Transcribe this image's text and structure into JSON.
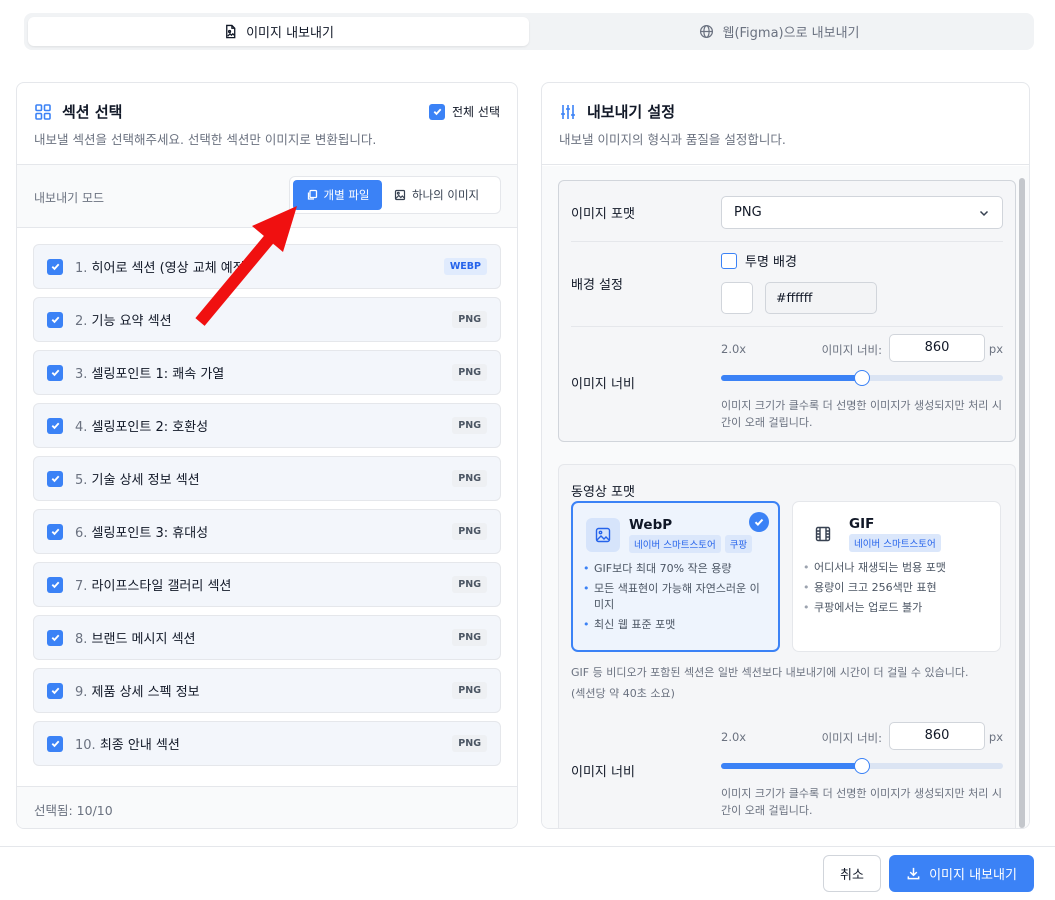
{
  "tabs": [
    {
      "label": "이미지 내보내기",
      "active": true
    },
    {
      "label": "웹(Figma)으로 내보내기",
      "active": false
    }
  ],
  "left": {
    "title": "섹션 선택",
    "subtitle": "내보낼 섹션을 선택해주세요. 선택한 섹션만 이미지로 변환됩니다.",
    "select_all": "전체 선택",
    "mode_label": "내보내기 모드",
    "mode_options": [
      "개별 파일",
      "하나의 이미지"
    ],
    "sections": [
      {
        "num": "1.",
        "name": "히어로 섹션 (영상 교체 예정)",
        "badge": "WEBP"
      },
      {
        "num": "2.",
        "name": "기능 요약 섹션",
        "badge": "PNG"
      },
      {
        "num": "3.",
        "name": "셀링포인트 1: 쾌속 가열",
        "badge": "PNG"
      },
      {
        "num": "4.",
        "name": "셀링포인트 2: 호환성",
        "badge": "PNG"
      },
      {
        "num": "5.",
        "name": "기술 상세 정보 섹션",
        "badge": "PNG"
      },
      {
        "num": "6.",
        "name": "셀링포인트 3: 휴대성",
        "badge": "PNG"
      },
      {
        "num": "7.",
        "name": "라이프스타일 갤러리 섹션",
        "badge": "PNG"
      },
      {
        "num": "8.",
        "name": "브랜드 메시지 섹션",
        "badge": "PNG"
      },
      {
        "num": "9.",
        "name": "제품 상세 스펙 정보",
        "badge": "PNG"
      },
      {
        "num": "10.",
        "name": "최종 안내 섹션",
        "badge": "PNG"
      }
    ],
    "footer": "선택됨: 10/10"
  },
  "right": {
    "title": "내보내기 설정",
    "subtitle": "내보낼 이미지의 형식과 품질을 설정합니다.",
    "image_format_label": "이미지 포맷",
    "image_format_value": "PNG",
    "bg_label": "배경 설정",
    "transparent_label": "투명 배경",
    "bg_color": "#ffffff",
    "width_label": "이미지 너비",
    "scale": "2.0x",
    "width_field_label": "이미지 너비:",
    "width_value": "860",
    "unit": "px",
    "slider_fraction": 0.5,
    "hint": "이미지 크기가 클수록 더 선명한 이미지가 생성되지만 처리 시간이 오래 걸립니다.",
    "video": {
      "title": "동영상 포맷",
      "cards": [
        {
          "name": "WebP",
          "tags": [
            "네이버 스마트스토어",
            "쿠팡"
          ],
          "features": [
            "GIF보다 최대 70% 작은 용량",
            "모든 색표현이 가능해 자연스러운 이미지",
            "최신 웹 표준 포맷"
          ],
          "selected": true
        },
        {
          "name": "GIF",
          "tags": [
            "네이버 스마트스토어"
          ],
          "features": [
            "어디서나 재생되는 범용 포맷",
            "용량이 크고 256색만 표현",
            "쿠팡에서는 업로드 불가"
          ],
          "selected": false
        }
      ],
      "note_1": "GIF 등 비디오가 포함된 섹션은 일반 섹션보다 내보내기에 시간이 더 걸릴 수 있습니다.",
      "note_2": "(섹션당 약 40초 소요)",
      "width_label": "이미지 너비",
      "scale": "2.0x",
      "width_field_label": "이미지 너비:",
      "width_value": "860",
      "unit": "px",
      "slider_fraction": 0.5,
      "hint": "이미지 크기가 클수록 더 선명한 이미지가 생성되지만 처리 시간이 오래 걸립니다."
    }
  },
  "footer": {
    "cancel": "취소",
    "export": "이미지 내보내기"
  },
  "colors": {
    "accent": "#3b82f6",
    "annotation_arrow": "#f01010"
  }
}
